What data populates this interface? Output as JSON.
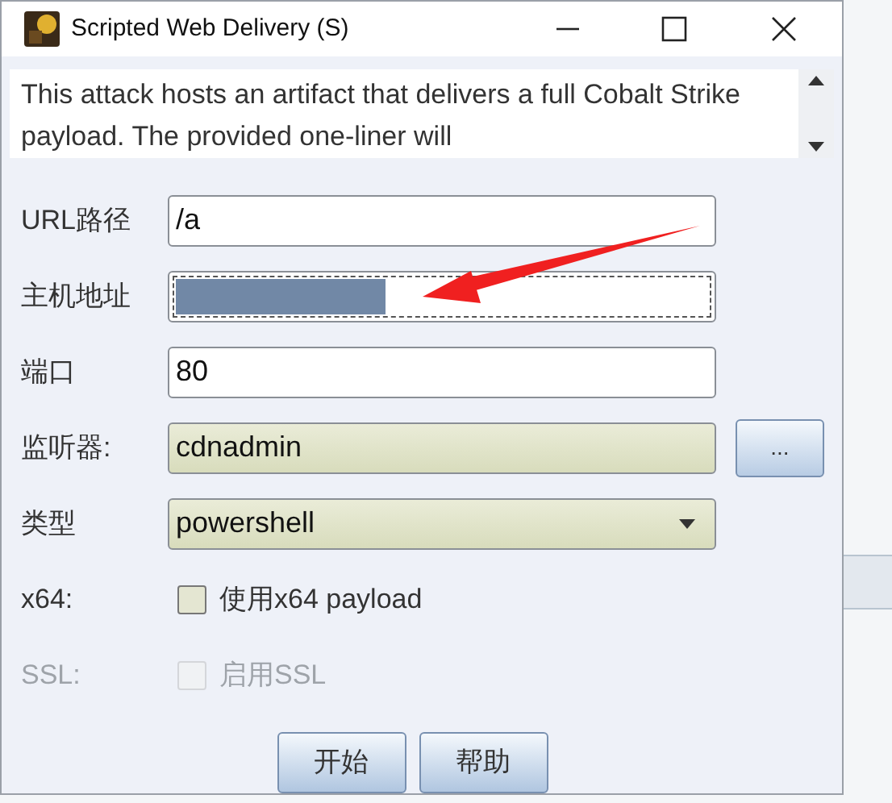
{
  "window": {
    "title": "Scripted Web Delivery (S)"
  },
  "description": "This attack hosts an artifact that delivers a full Cobalt Strike payload. The provided one-liner will",
  "fields": [
    {
      "kind": "text",
      "label": "URL路径",
      "value": "/a"
    },
    {
      "kind": "redacted",
      "label": "主机地址",
      "focused": true
    },
    {
      "kind": "text",
      "label": "端口",
      "value": "80"
    },
    {
      "kind": "picker",
      "label": "监听器:",
      "value": "cdnadmin",
      "button": "..."
    },
    {
      "kind": "combo",
      "label": "类型",
      "value": "powershell"
    },
    {
      "kind": "checkbox",
      "label": "x64:",
      "text": "使用x64 payload",
      "checked": false,
      "disabled": false
    },
    {
      "kind": "checkbox",
      "label": "SSL:",
      "text": "启用SSL",
      "checked": false,
      "disabled": true
    }
  ],
  "buttons": [
    "开始",
    "帮助"
  ]
}
